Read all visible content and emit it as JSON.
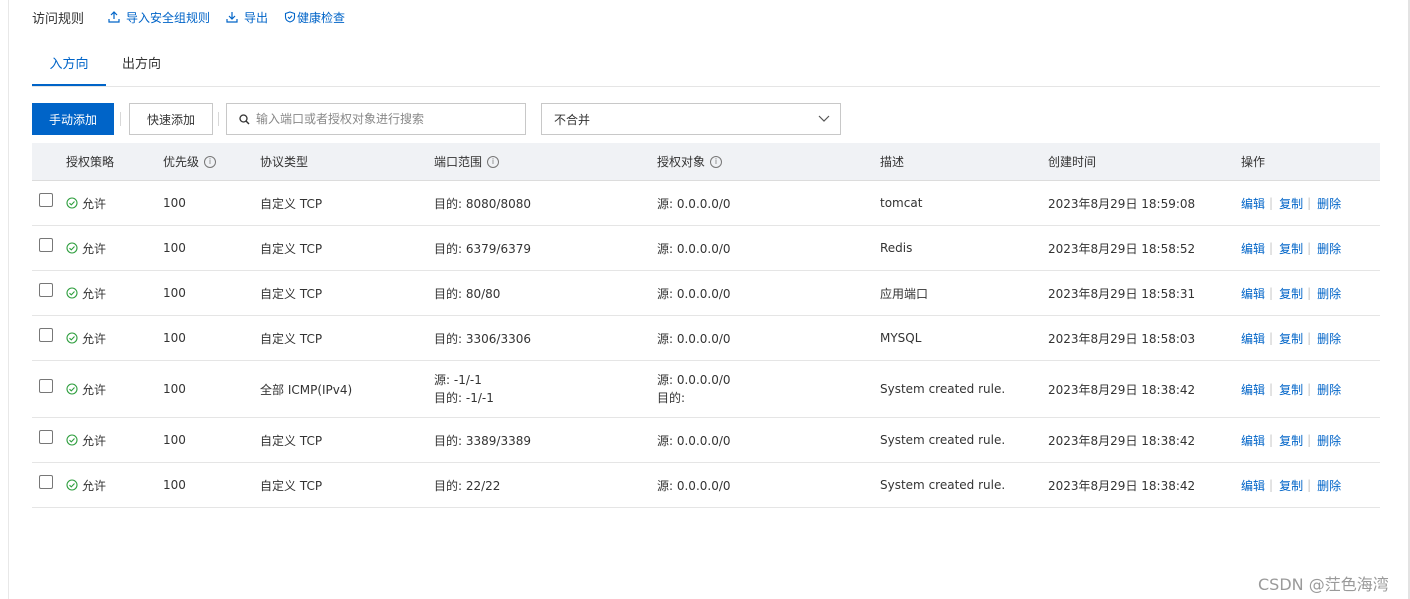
{
  "header": {
    "title": "访问规则",
    "import_label": "导入安全组规则",
    "export_label": "导出",
    "health_label": "健康检查"
  },
  "tabs": [
    {
      "label": "入方向",
      "active": true
    },
    {
      "label": "出方向",
      "active": false
    }
  ],
  "toolbar": {
    "manual_add_label": "手动添加",
    "quick_add_label": "快速添加",
    "search_placeholder": "输入端口或者授权对象进行搜索",
    "merge_select_value": "不合并"
  },
  "table": {
    "columns": {
      "policy": "授权策略",
      "priority": "优先级",
      "protocol": "协议类型",
      "port_range": "端口范围",
      "auth_object": "授权对象",
      "description": "描述",
      "created_at": "创建时间",
      "actions": "操作"
    },
    "rows": [
      {
        "policy": "允许",
        "priority": "100",
        "protocol": "自定义 TCP",
        "port": "目的: 8080/8080",
        "auth": "源: 0.0.0.0/0",
        "desc": "tomcat",
        "time": "2023年8月29日 18:59:08"
      },
      {
        "policy": "允许",
        "priority": "100",
        "protocol": "自定义 TCP",
        "port": "目的: 6379/6379",
        "auth": "源: 0.0.0.0/0",
        "desc": "Redis",
        "time": "2023年8月29日 18:58:52"
      },
      {
        "policy": "允许",
        "priority": "100",
        "protocol": "自定义 TCP",
        "port": "目的: 80/80",
        "auth": "源: 0.0.0.0/0",
        "desc": "应用端口",
        "time": "2023年8月29日 18:58:31"
      },
      {
        "policy": "允许",
        "priority": "100",
        "protocol": "自定义 TCP",
        "port": "目的: 3306/3306",
        "auth": "源: 0.0.0.0/0",
        "desc": "MYSQL",
        "time": "2023年8月29日 18:58:03"
      },
      {
        "policy": "允许",
        "priority": "100",
        "protocol": "全部 ICMP(IPv4)",
        "port": "源: -1/-1",
        "port2": "目的: -1/-1",
        "auth": "源: 0.0.0.0/0",
        "auth2": "目的:",
        "desc": "System created rule.",
        "time": "2023年8月29日 18:38:42"
      },
      {
        "policy": "允许",
        "priority": "100",
        "protocol": "自定义 TCP",
        "port": "目的: 3389/3389",
        "auth": "源: 0.0.0.0/0",
        "desc": "System created rule.",
        "time": "2023年8月29日 18:38:42"
      },
      {
        "policy": "允许",
        "priority": "100",
        "protocol": "自定义 TCP",
        "port": "目的: 22/22",
        "auth": "源: 0.0.0.0/0",
        "desc": "System created rule.",
        "time": "2023年8月29日 18:38:42"
      }
    ],
    "actions": {
      "edit": "编辑",
      "copy": "复制",
      "delete": "删除"
    }
  },
  "watermark": "CSDN @茳色海湾",
  "icons": {
    "import": "upload-icon",
    "export": "download-icon",
    "health": "shield-check-icon",
    "search": "search-icon",
    "select": "chevron-down-icon",
    "info": "info-icon",
    "allow": "check-circle-icon"
  },
  "colors": {
    "accent": "#0064c8",
    "allow_green": "#2e9e3e",
    "header_bg": "#f0f2f5"
  }
}
